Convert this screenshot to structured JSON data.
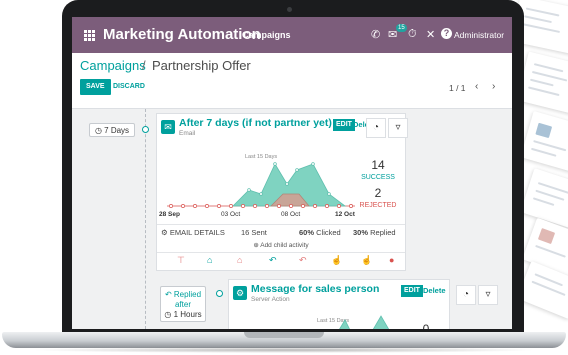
{
  "app": {
    "title": "Marketing Automation",
    "menu": "Campaigns",
    "user": "Administrator",
    "chat_badge": "15"
  },
  "breadcrumb": {
    "parent": "Campaigns",
    "separator": "/",
    "current": "Partnership Offer"
  },
  "buttons": {
    "save": "SAVE",
    "discard": "DISCARD"
  },
  "pager": {
    "label": "1 / 1"
  },
  "activities": [
    {
      "trigger": "7 Days",
      "title": "After 7 days (if not partner yet)",
      "type": "Email",
      "edit_label": "EDIT",
      "delete_label": "Delete",
      "graph_label": "Last 15 Days",
      "success_count": "14",
      "success_label": "SUCCESS",
      "rejected_count": "2",
      "rejected_label": "REJECTED",
      "dates": [
        "28 Sep",
        "03 Oct",
        "08 Oct",
        "12 Oct"
      ],
      "stats": {
        "details": "EMAIL DETAILS",
        "sent": "16 Sent",
        "clicked_pct": "60%",
        "clicked": "Clicked",
        "replied_pct": "30%",
        "replied": "Replied"
      },
      "add_child": "Add child activity"
    },
    {
      "trigger_lines": [
        "Replied",
        "after",
        "1 Hours"
      ],
      "title": "Message for sales person",
      "type": "Server Action",
      "edit_label": "EDIT",
      "delete_label": "Delete",
      "graph_label": "Last 15 Days",
      "success_count": "0"
    }
  ],
  "colors": {
    "navbar": "#7c5d7b",
    "accent": "#00a09d",
    "rejected": "#d9534f",
    "success_fill": "#7fd3c1",
    "rejected_fill": "#c8a597"
  },
  "icons": [
    "apps-grid-icon",
    "phone-icon",
    "chat-icon",
    "activity-icon",
    "close-icon",
    "user-icon",
    "clock-icon",
    "envelope-icon",
    "pie-chart-icon",
    "filter-icon",
    "gears-icon",
    "reply-icon",
    "plus-circle-icon"
  ]
}
